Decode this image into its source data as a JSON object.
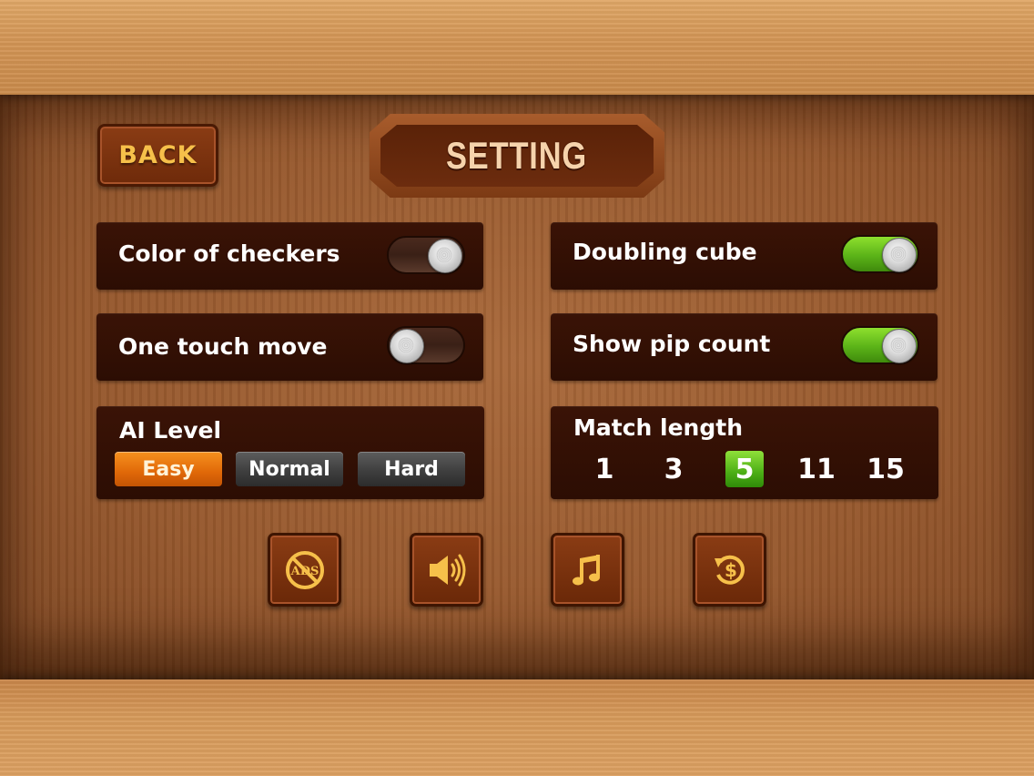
{
  "header": {
    "back_label": "BACK",
    "title": "SETTING"
  },
  "settings": {
    "color_of_checkers": {
      "label": "Color of checkers",
      "state": "off"
    },
    "doubling_cube": {
      "label": "Doubling cube",
      "state": "on"
    },
    "one_touch_move": {
      "label": "One touch move",
      "state": "off"
    },
    "show_pip_count": {
      "label": "Show pip count",
      "state": "on"
    }
  },
  "ai_level": {
    "label": "AI Level",
    "options": [
      "Easy",
      "Normal",
      "Hard"
    ],
    "selected": "Easy"
  },
  "match_length": {
    "label": "Match length",
    "options": [
      "1",
      "3",
      "5",
      "11",
      "15"
    ],
    "selected": "5"
  },
  "bottom_buttons": [
    {
      "icon": "no-ads-icon",
      "text": "ADS"
    },
    {
      "icon": "sound-icon"
    },
    {
      "icon": "music-icon"
    },
    {
      "icon": "restore-purchase-icon"
    }
  ],
  "colors": {
    "accent_gold": "#f6c04a",
    "toggle_on": "#5bb318",
    "level_selected": "#e06808"
  }
}
